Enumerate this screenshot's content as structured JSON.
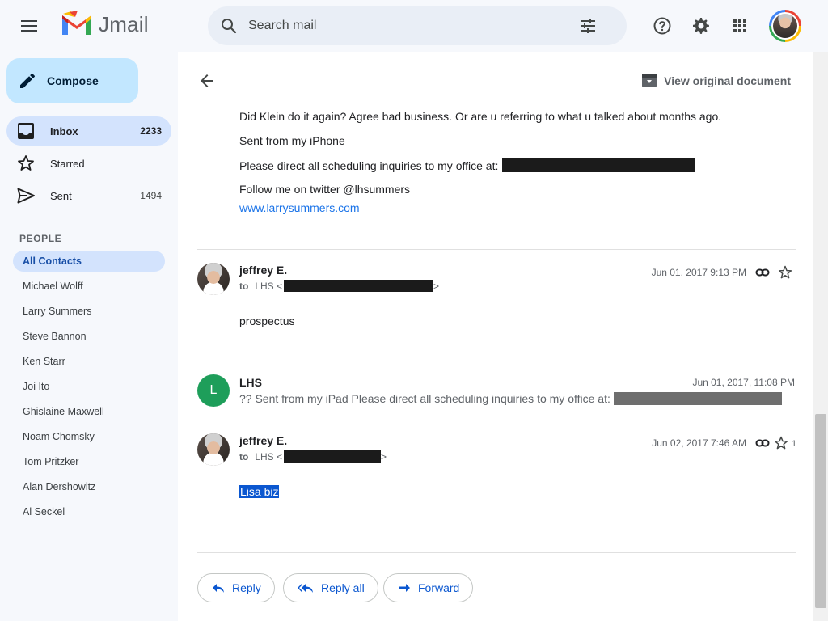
{
  "app": {
    "name": "Jmail"
  },
  "search": {
    "placeholder": "Search mail"
  },
  "compose": {
    "label": "Compose"
  },
  "nav": [
    {
      "label": "Inbox",
      "count": "2233"
    },
    {
      "label": "Starred",
      "count": ""
    },
    {
      "label": "Sent",
      "count": "1494"
    }
  ],
  "people": {
    "heading": "PEOPLE",
    "contacts": [
      "All Contacts",
      "Michael Wolff",
      "Larry Summers",
      "Steve Bannon",
      "Ken Starr",
      "Joi Ito",
      "Ghislaine Maxwell",
      "Noam Chomsky",
      "Tom Pritzker",
      "Alan Dershowitz",
      "Al Seckel"
    ]
  },
  "toolbar": {
    "view_original": "View original document"
  },
  "first_message": {
    "line1": "Did Klein do it again? Agree bad business. Or are u referring to what u talked about months ago.",
    "line2": "Sent from my iPhone",
    "line3": "Please direct all scheduling inquiries to my office at:",
    "line4": "Follow me on twitter @lhsummers",
    "link": "www.larrysummers.com"
  },
  "messages": [
    {
      "sender": "jeffrey E.",
      "to_label": "to",
      "to_name": "LHS <",
      "to_end": ">",
      "date": "Jun 01, 2017 9:13 PM",
      "body": "prospectus"
    },
    {
      "sender": "LHS",
      "initial": "L",
      "date": "Jun 01, 2017, 11:08 PM",
      "snippet": "?? Sent from my iPad Please direct all scheduling inquiries to my office at:"
    },
    {
      "sender": "jeffrey E.",
      "to_label": "to",
      "to_name": "LHS <",
      "to_end": ">",
      "date": "Jun 02, 2017 7:46 AM",
      "body": "Lisa biz",
      "star_count": "1"
    }
  ],
  "actions": {
    "reply": "Reply",
    "reply_all": "Reply all",
    "forward": "Forward"
  },
  "colors": {
    "compose_bg": "#c2e7ff",
    "active_nav": "#d3e3fd",
    "link": "#1a73e8",
    "green_avatar": "#1e9e5a"
  }
}
